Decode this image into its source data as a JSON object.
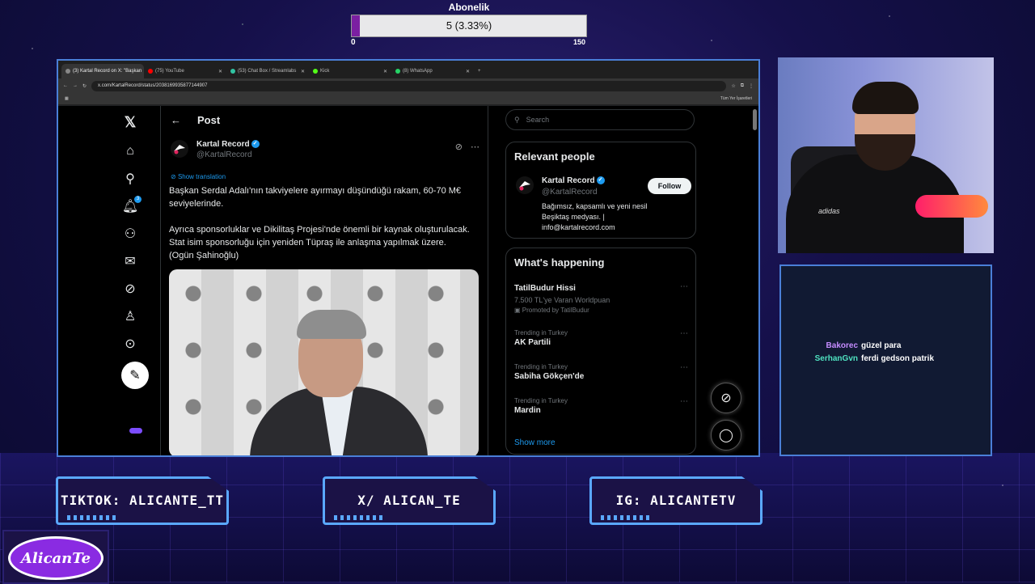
{
  "subs": {
    "title": "Abonelik",
    "text": "5 (3.33%)",
    "min": "0",
    "max": "150",
    "progress": 0.0333,
    "fill_color": "#7b1fa2"
  },
  "browser": {
    "tabs": [
      {
        "label": "(3) Kartal Record on X: \"Başkan",
        "icon_color": "#888"
      },
      {
        "label": "(75) YouTube",
        "icon_color": "#ff0000"
      },
      {
        "label": "(53) Chat Box / Streamlabs",
        "icon_color": "#31c3a2"
      },
      {
        "label": "Kick",
        "icon_color": "#53fc18"
      },
      {
        "label": "(8) WhatsApp",
        "icon_color": "#25d366"
      }
    ],
    "url": "x.com/KartalRecord/status/2038169935877144907",
    "bookmarks_right": "Tüm Yer İşaretleri"
  },
  "x": {
    "header_title": "Post",
    "author_name": "Kartal Record",
    "author_handle": "@KartalRecord",
    "show_translation": "Show translation",
    "post_paragraphs": [
      "Başkan Serdal Adalı'nın takviyelere ayırmayı düşündüğü rakam, 60-70 M€ seviyelerinde.",
      "Ayrıca sponsorluklar ve Dikilitaş Projesi'nde önemli bir kaynak oluşturulacak. Stat isim sponsorluğu için yeniden Tüpraş ile anlaşma yapılmak üzere. (Ogün Şahinoğlu)"
    ],
    "notification_count": "3",
    "search_placeholder": "Search",
    "relevant_title": "Relevant people",
    "relevant": {
      "name": "Kartal Record",
      "handle": "@KartalRecord",
      "bio": "Bağımsız, kapsamlı ve yeni nesil Beşiktaş medyası. | info@kartalrecord.com",
      "follow_label": "Follow"
    },
    "happening_title": "What's happening",
    "trends": [
      {
        "meta": "",
        "name": "TatilBudur Hissi",
        "sub": "7.500 TL'ye Varan Worldpuan",
        "promo": "Promoted by TatilBudur"
      },
      {
        "meta": "Trending in Turkey",
        "name": "AK Partili",
        "sub": "",
        "promo": ""
      },
      {
        "meta": "Trending in Turkey",
        "name": "Sabiha Gökçen'de",
        "sub": "",
        "promo": ""
      },
      {
        "meta": "Trending in Turkey",
        "name": "Mardin",
        "sub": "",
        "promo": ""
      }
    ],
    "show_more": "Show more"
  },
  "chat": {
    "messages": [
      {
        "user": "Bakorec",
        "text": "güzel para",
        "color": "#c58cff"
      },
      {
        "user": "SerhanGvn",
        "text": "ferdi gedson patrik",
        "color": "#4fe3c1"
      }
    ]
  },
  "socials": {
    "tiktok": "TIKTOK: ALICANTE_TT",
    "x": "X/ ALICAN_TE",
    "ig": "IG: ALICANTETV"
  },
  "brand": {
    "logo_text": "AlicanTe"
  },
  "cam": {
    "shirt_logo": "adidas"
  }
}
